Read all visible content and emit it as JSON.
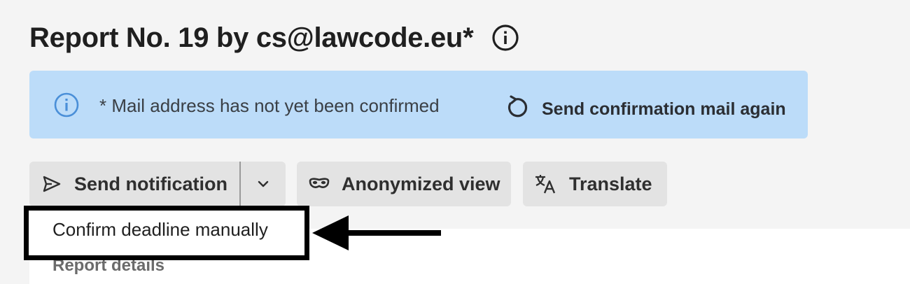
{
  "page": {
    "title": "Report No. 19 by cs@lawcode.eu*"
  },
  "banner": {
    "message": "* Mail address has not yet been confirmed",
    "action_label": "Send confirmation mail again",
    "background_color": "#bcdcf9",
    "icon_color": "#4a8fd8"
  },
  "toolbar": {
    "send_notification_label": "Send notification",
    "anonymized_view_label": "Anonymized view",
    "translate_label": "Translate"
  },
  "dropdown": {
    "items": [
      {
        "label": "Confirm deadline manually"
      }
    ]
  },
  "content": {
    "section_heading": "Report details"
  },
  "icons": {
    "title_info": "info-circle-icon",
    "banner_info": "info-circle-icon",
    "resend": "refresh-icon",
    "send": "send-arrow-icon",
    "toggle": "chevron-down-icon",
    "anonymized": "mask-icon",
    "translate": "translate-icon"
  }
}
